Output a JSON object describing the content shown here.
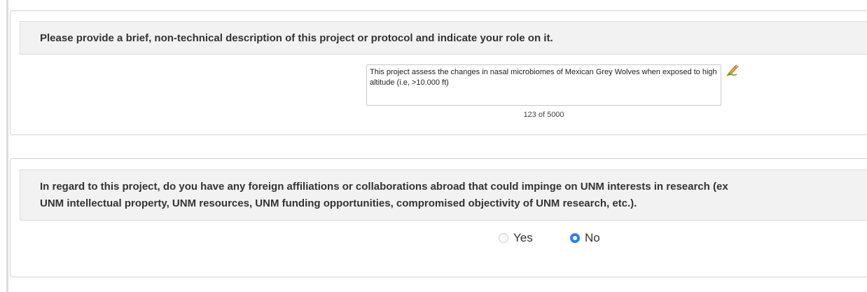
{
  "question_1": {
    "text": "Please provide a brief, non-technical description of this project or protocol and indicate your role on it.",
    "answer": "This project assess the changes in nasal microbiomes of Mexican Grey Wolves when exposed to high altitude (i.e, >10.000 ft)",
    "counter": "123 of 5000",
    "edit_icon": "pencil-icon"
  },
  "question_2": {
    "text_line_1": "In regard to this project, do you have any foreign affiliations or collaborations abroad that could impinge on UNM interests in research (ex",
    "text_line_2": "UNM intellectual property, UNM resources, UNM funding opportunities, compromised objectivity of UNM research, etc.).",
    "options": [
      {
        "label": "Yes",
        "selected": false
      },
      {
        "label": "No",
        "selected": true
      }
    ],
    "selected_value": "No"
  },
  "colors": {
    "radio_selected": "#2f7cf6",
    "question_background": "#f2f2f2",
    "panel_border": "#d4d4d4"
  }
}
